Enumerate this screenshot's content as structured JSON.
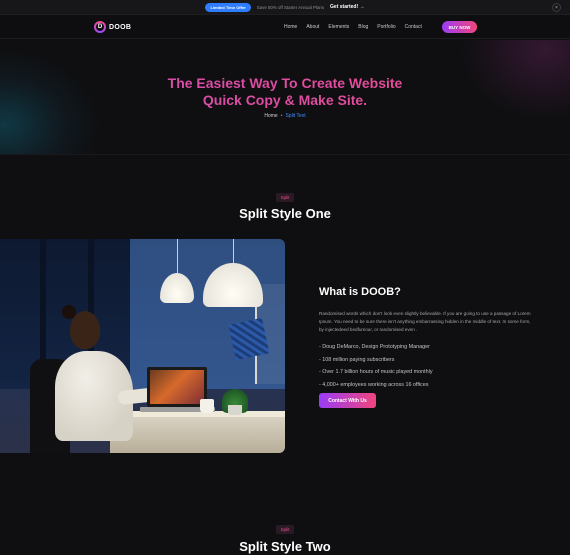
{
  "promo": {
    "badge": "Limited Time Offer",
    "text": "Save 50% off Starter Annual Plans",
    "link": "Get started!",
    "link_arrow": "→",
    "close": "×"
  },
  "header": {
    "logo_text": "DOOB",
    "logo_mark": "D",
    "nav": [
      "Home",
      "About",
      "Elements",
      "Blog",
      "Portfolio",
      "Contact"
    ],
    "buy_label": "BUY NOW"
  },
  "hero": {
    "title_line1": "The Easiest Way To Create Website",
    "title_line2": "Quick Copy & Make Site.",
    "breadcrumb_home": "Home",
    "breadcrumb_sep": "•",
    "breadcrumb_current": "Split Text"
  },
  "section1": {
    "tag": "Split",
    "title": "Split Style One",
    "heading": "What is DOOB?",
    "description": "Randomised words which don't look even slightly believable. If you are going to use a passage of Lorem Ipsum. You need to be sure there isn't anything embarrassing hidden in the middle of text. In some form, by injectedeed bedfumour, or randomised even .",
    "bullets": [
      "- Doug DeMarco, Design Prototyping Manager",
      "- 108 million paying subscribers",
      "- Over 1.7 billion hours of music played monthly",
      "- 4,000+ employees working across 16 offices"
    ],
    "button": "Contact With Us"
  },
  "section2": {
    "tag": "Split",
    "title": "Split Style Two"
  },
  "colors": {
    "accent_gradient_start": "#9b3cf7",
    "accent_gradient_end": "#f2457b",
    "breadcrumb_current": "#3d8cff",
    "promo_badge": "#2f7dff",
    "background": "#0f0f11"
  }
}
